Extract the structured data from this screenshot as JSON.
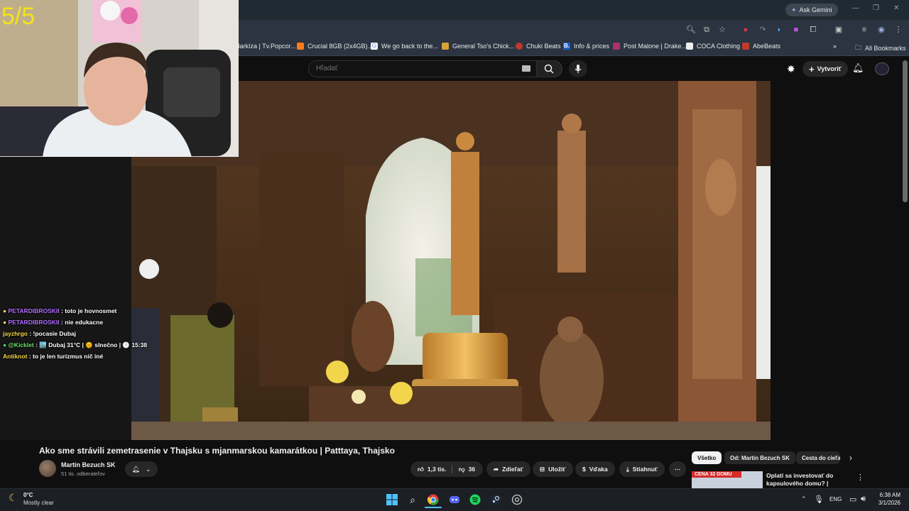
{
  "overlay": {
    "counter": "5/5",
    "chat": [
      {
        "badge_color": "#e6d84b",
        "user": "PETARDIBROSKII",
        "user_color": "#b06dff",
        "message": ": toto je hovnosmet"
      },
      {
        "badge_color": "#e6d84b",
        "user": "PETARDIBROSKII",
        "user_color": "#b06dff",
        "message": ": nie edukacne"
      },
      {
        "badge_color": "",
        "user": "jayzhrgo",
        "user_color": "#f5d742",
        "message": ": !pocasie Dubaj"
      },
      {
        "badge_color": "#4cd964",
        "user": "@Kicklet",
        "user_color": "#6fe36a",
        "message": ": 🏙️ Dubaj 31°C | 🌞 slnečno | 🕒 15:38"
      },
      {
        "badge_color": "",
        "user": "Antiknot",
        "user_color": "#f5d742",
        "message": ": to je len turizmus nič iné"
      }
    ]
  },
  "browser": {
    "ask_gemini": "Ask Gemini",
    "bookmarks": [
      {
        "label": "Markíza | Tv.Popcor...",
        "color": "#e83a3a"
      },
      {
        "label": "Crucial 8GB (2x4GB)...",
        "color": "#ff7a1a"
      },
      {
        "label": "We go back to the...",
        "color": "#4285f4"
      },
      {
        "label": "General Tso's Chick...",
        "color": "#d9a036"
      },
      {
        "label": "Chuki Beats",
        "color": "#c0392b"
      },
      {
        "label": "Info & prices",
        "color": "#1a5fd1"
      },
      {
        "label": "Post Malone | Drake...",
        "color": "#b0306a"
      },
      {
        "label": "COCA Clothing",
        "color": "#eeeeee"
      },
      {
        "label": "AbeBeats",
        "color": "#c0392b"
      }
    ],
    "all_bookmarks": "All Bookmarks"
  },
  "youtube": {
    "search_placeholder": "Hľadať",
    "create_label": "Vytvoriť",
    "video_title": "Ako sme strávili zemetrasenie v Thajsku s mjanmarskou kamarátkou | Patttaya, Thajsko",
    "channel_name": "Martin Bezuch SK",
    "subscribers": "51 tis. odberateľov",
    "likes": "1,3 tis.",
    "dislikes": "36",
    "actions": {
      "share": "Zdieľať",
      "save": "Uložiť",
      "thanks": "Vďaka",
      "download": "Stiahnuť"
    },
    "chips": [
      "Všetko",
      "Od: Martin Bezuch SK",
      "Cesta do cieľa"
    ],
    "recommended": {
      "thumb_text": "CENA 32 DOMU",
      "title": "Oplatí sa investovať do kapsulového domu? | Pattaya, ..."
    }
  },
  "taskbar": {
    "weather_temp": "0°C",
    "weather_desc": "Mostly clear",
    "lang": "ENG",
    "time": "6:38 AM",
    "date": "3/1/2026"
  }
}
